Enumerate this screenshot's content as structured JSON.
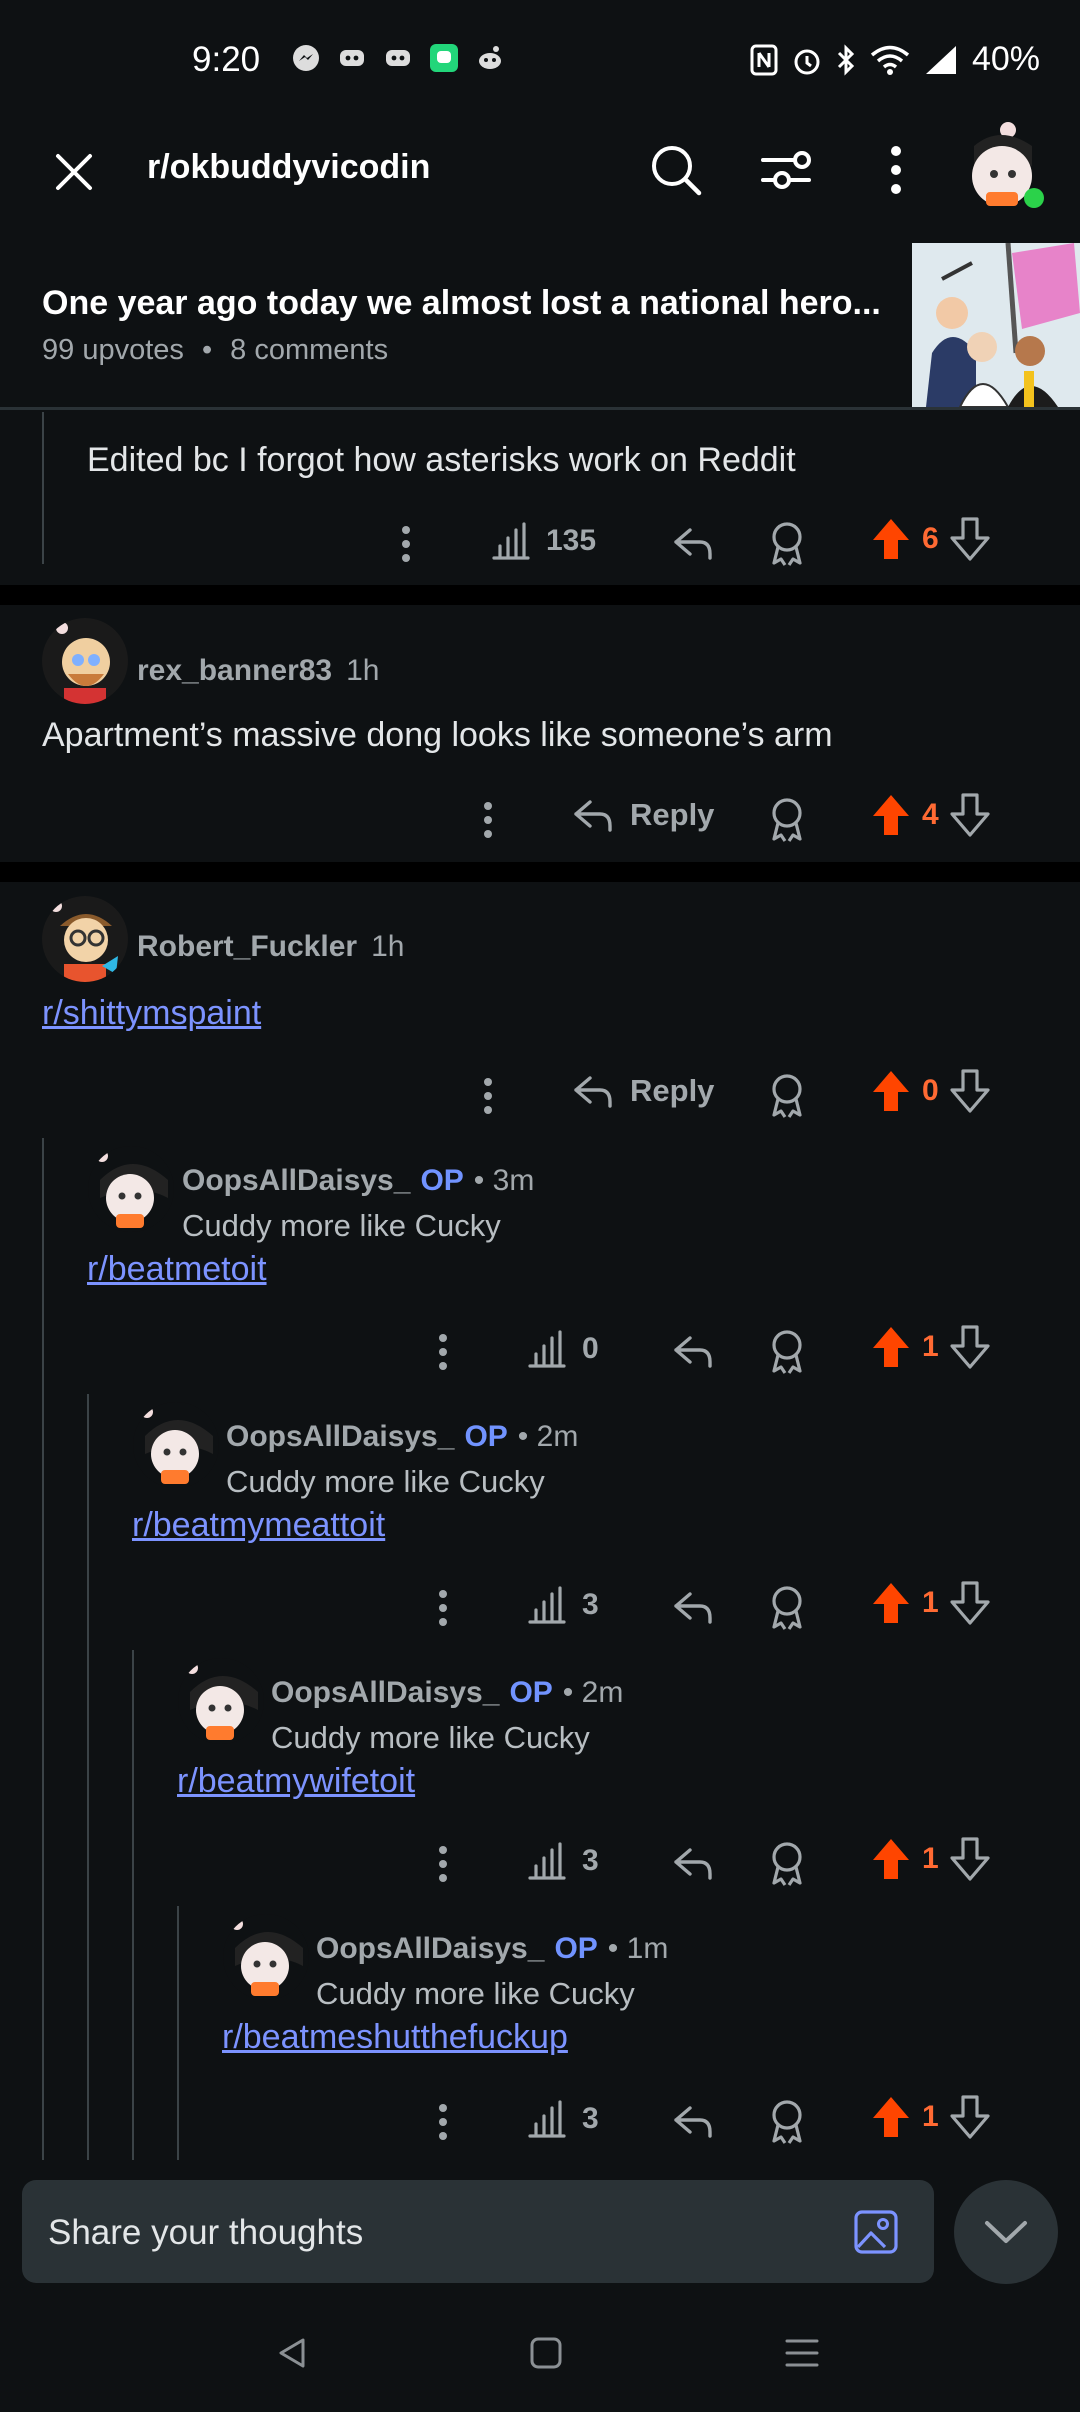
{
  "status_bar": {
    "time": "9:20",
    "battery": "40%"
  },
  "header": {
    "subreddit": "r/okbuddyvicodin"
  },
  "post": {
    "title": "One year ago today we almost lost a national hero...",
    "upvotes": "99 upvotes",
    "dot": "•",
    "comments": "8 comments"
  },
  "comments": [
    {
      "text": "Edited bc I forgot how asterisks work on Reddit",
      "views": "135",
      "votes": "6"
    },
    {
      "username": "rex_banner83",
      "time": "1h",
      "text": "Apartment’s massive dong looks like someone’s arm",
      "reply": "Reply",
      "votes": "4"
    },
    {
      "username": "Robert_Fuckler",
      "time": "1h",
      "link": "r/shittymspaint",
      "reply": "Reply",
      "votes": "0"
    },
    {
      "username": "OopsAllDaisys_",
      "op": "OP",
      "time": "• 3m",
      "flair": "Cuddy more like Cucky",
      "link": "r/beatmetoit",
      "views": "0",
      "votes": "1"
    },
    {
      "username": "OopsAllDaisys_",
      "op": "OP",
      "time": "• 2m",
      "flair": "Cuddy more like Cucky",
      "link": "r/beatmymeattoit",
      "views": "3",
      "votes": "1"
    },
    {
      "username": "OopsAllDaisys_",
      "op": "OP",
      "time": "• 2m",
      "flair": "Cuddy more like Cucky",
      "link": "r/beatmywifetoit",
      "views": "3",
      "votes": "1"
    },
    {
      "username": "OopsAllDaisys_",
      "op": "OP",
      "time": "• 1m",
      "flair": "Cuddy more like Cucky",
      "link": "r/beatmeshutthefuckup",
      "views": "3",
      "votes": "1"
    }
  ],
  "composer": {
    "placeholder": "Share your thoughts"
  },
  "colors": {
    "upvote": "#ff4500",
    "link": "#7c93ff",
    "op": "#7193ff",
    "background": "#0e1113"
  },
  "icons": [
    "close-icon",
    "search-icon",
    "filter-icon",
    "more-icon",
    "upvote-icon",
    "downvote-icon",
    "reply-icon",
    "award-icon",
    "stats-icon",
    "image-icon",
    "chevron-down-icon"
  ]
}
